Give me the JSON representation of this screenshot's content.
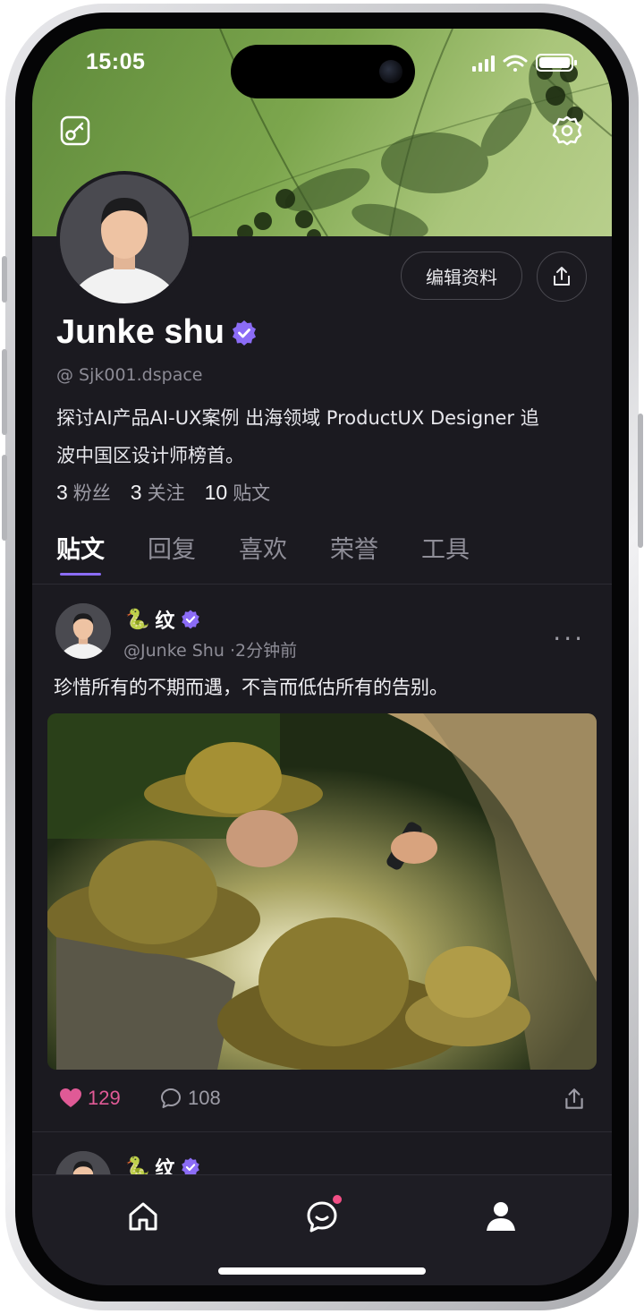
{
  "status_bar": {
    "time": "15:05"
  },
  "profile": {
    "name": "Junke shu",
    "handle": "@ Sjk001.dspace",
    "bio_line1": "探讨AI产品AI-UX案例  出海领域 ProductUX Designer  追",
    "bio_line2": "波中国区设计师榜首。",
    "stats": [
      {
        "count": "3",
        "label": "粉丝"
      },
      {
        "count": "3",
        "label": "关注"
      },
      {
        "count": "10",
        "label": "贴文"
      }
    ],
    "edit_button": "编辑资料"
  },
  "tabs": [
    {
      "label": "贴文",
      "active": true
    },
    {
      "label": "回复",
      "active": false
    },
    {
      "label": "喜欢",
      "active": false
    },
    {
      "label": "荣誉",
      "active": false
    },
    {
      "label": "工具",
      "active": false
    }
  ],
  "post": {
    "author_emoji": "🐍",
    "author_name": "纹",
    "handle": "@Junke Shu",
    "time": "·2分钟前",
    "text": "珍惜所有的不期而遇，不言而低估所有的告别。",
    "likes": "129",
    "comments": "108"
  },
  "next_post": {
    "author_emoji": "🐍",
    "author_name": "纹"
  },
  "colors": {
    "accent": "#8b6cf6",
    "like": "#e05a96",
    "background": "#1b1a20",
    "badge": "#f24f86"
  },
  "icons": [
    "key-icon",
    "settings-gear-icon",
    "share-icon",
    "verified-badge-icon",
    "heart-icon",
    "comment-icon",
    "home-icon",
    "messages-icon",
    "profile-icon"
  ]
}
